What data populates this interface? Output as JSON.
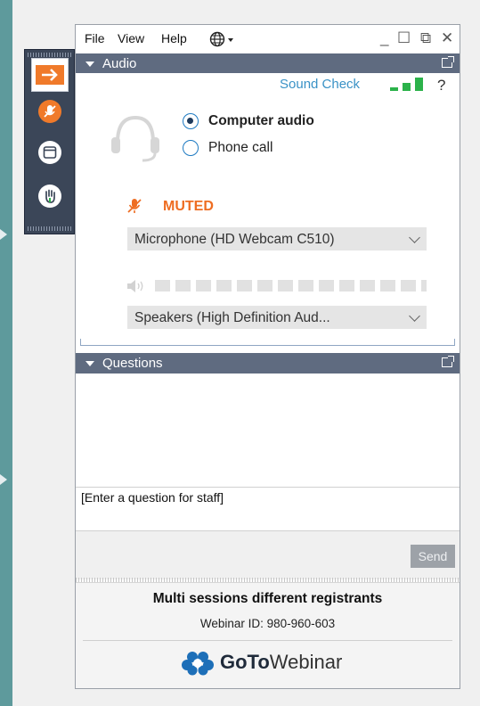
{
  "menu": {
    "file": "File",
    "view": "View",
    "help": "Help"
  },
  "window_controls": {
    "minimize": "_",
    "maximize": "☐",
    "popout": "⧉",
    "close": "✕"
  },
  "audio": {
    "header": "Audio",
    "sound_check": "Sound Check",
    "help": "?",
    "options": [
      "Computer audio",
      "Phone call"
    ],
    "selected_option": "Computer audio",
    "mic_status": "MUTED",
    "microphone": "Microphone (HD Webcam C510)",
    "speaker_level": 0,
    "speakers": "Speakers (High Definition Aud..."
  },
  "questions": {
    "header": "Questions",
    "input_placeholder": "[Enter a question for staff]",
    "send_label": "Send"
  },
  "session": {
    "title": "Multi sessions different registrants",
    "webinar_id": "Webinar ID: 980-960-603"
  },
  "brand": {
    "bold": "GoTo",
    "regular": "Webinar"
  },
  "sidebar": {
    "items": [
      {
        "icon": "collapse-arrow-icon",
        "active": true
      },
      {
        "icon": "muted-microphone-icon",
        "active": false
      },
      {
        "icon": "window-icon",
        "active": false
      },
      {
        "icon": "raise-hand-icon",
        "active": false
      }
    ]
  },
  "colors": {
    "accent_orange": "#ee6d22",
    "link_blue": "#3a92c6",
    "header_slate": "#5f6b80",
    "signal_green": "#2bb24a"
  }
}
